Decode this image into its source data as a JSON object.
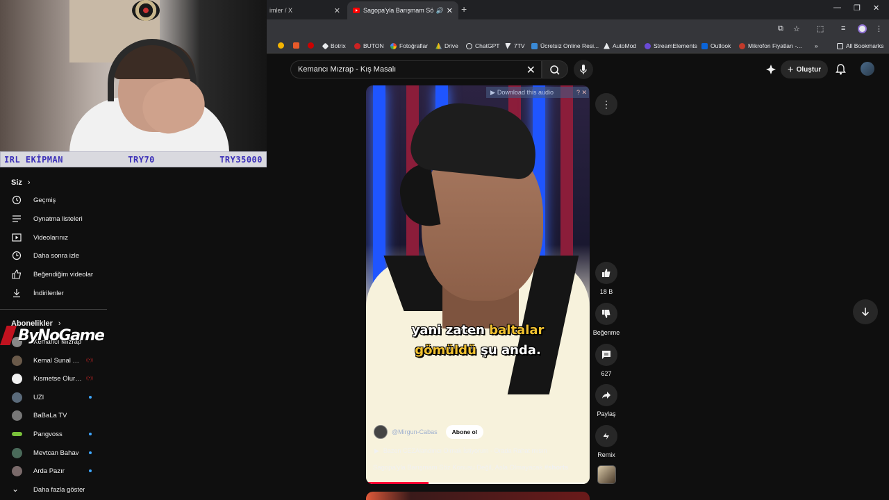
{
  "browser": {
    "tabs": [
      {
        "label": "imler / X"
      },
      {
        "label": "Sagopa'yla Barışmam Söz K"
      }
    ],
    "bookmarks": [
      {
        "label": "Botrix",
        "color": "#e8eaed"
      },
      {
        "label": "BUTON",
        "color": "#cc2222"
      },
      {
        "label": "Fotoğraflar",
        "color": "#f4b400"
      },
      {
        "label": "Drive",
        "color": "#34a853"
      },
      {
        "label": "ChatGPT",
        "color": "#e8eaed"
      },
      {
        "label": "7TV",
        "color": "#e8eaed"
      },
      {
        "label": "Ücretsiz Online Resi...",
        "color": "#3a8ad6"
      },
      {
        "label": "AutoMod",
        "color": "#e8eaed"
      },
      {
        "label": "StreamElements",
        "color": "#6a4ad6"
      },
      {
        "label": "Outlook",
        "color": "#0a64d8"
      },
      {
        "label": "Mikrofon Fiyatları -...",
        "color": "#c13a2a"
      }
    ],
    "all_bookmarks": "All Bookmarks"
  },
  "webcam": {
    "bar_left": "IRL EKİPMAN",
    "bar_mid": "TRY70",
    "bar_right": "TRY35000"
  },
  "header": {
    "search_value": "Kemancı Mızrap - Kış Masalı",
    "create_label": "Oluştur"
  },
  "sidebar": {
    "you_title": "Siz",
    "you_items": [
      {
        "label": "Geçmiş",
        "icon": "history-icon"
      },
      {
        "label": "Oynatma listeleri",
        "icon": "playlist-icon"
      },
      {
        "label": "Videolarınız",
        "icon": "your-videos-icon"
      },
      {
        "label": "Daha sonra izle",
        "icon": "watch-later-icon"
      },
      {
        "label": "Beğendiğim videolar",
        "icon": "liked-icon"
      },
      {
        "label": "İndirilenler",
        "icon": "download-icon"
      }
    ],
    "subs_title": "Abonelikler",
    "subs": [
      {
        "label": "Kemancı Mızrap",
        "color": "#888888",
        "indicator": ""
      },
      {
        "label": "Kemal Sunal Fil...",
        "color": "#6a5a4a",
        "indicator": "live"
      },
      {
        "label": "Kısmetse Olur: A...",
        "color": "#f1f1f1",
        "indicator": "live"
      },
      {
        "label": "UZI",
        "color": "#5a6a7a",
        "indicator": "dot"
      },
      {
        "label": "BaBaLa TV",
        "color": "#777777",
        "indicator": ""
      },
      {
        "label": "Pangvoss",
        "color": "#7ac13a",
        "indicator": "dot"
      },
      {
        "label": "Mevtcan Bahav",
        "color": "#4a6a5a",
        "indicator": "dot"
      },
      {
        "label": "Arda Pazır",
        "color": "#7a6a6a",
        "indicator": "dot"
      }
    ],
    "show_more": "Daha fazla göster"
  },
  "logo_text": "ByNoGame",
  "video": {
    "download_banner": "Download this audio",
    "caption_line1_a": "yani zaten ",
    "caption_line1_hl": "baltalar",
    "caption_line2_hl": "gömüldü",
    "caption_line2_b": " şu anda.",
    "channel": "@Mirgun-Cabas",
    "subscribe": "Abone ol",
    "music": "Bazen CEZAlandırıcı Olmak İstiyorum - Orada Rahat mısın",
    "title": "Sagopa'yla Barışmam Söz Konusu Değil, Asla Olmayacak",
    "hashtag": "#shorts",
    "progress": 0.28
  },
  "actions": {
    "likes": "18 B",
    "dislike": "Beğenme",
    "comments": "627",
    "share": "Paylaş",
    "remix": "Remix"
  }
}
